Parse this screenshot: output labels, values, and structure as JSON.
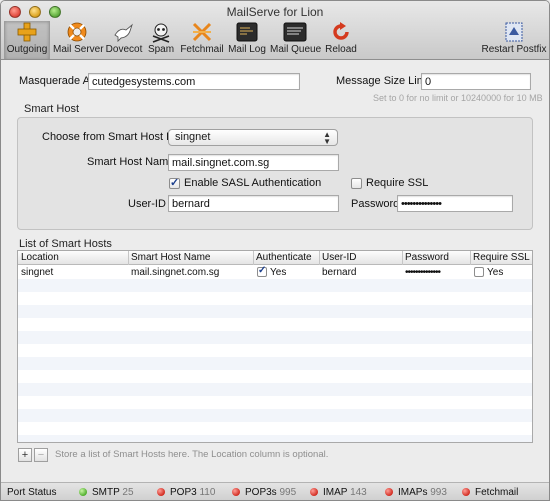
{
  "window": {
    "title": "MailServe for Lion"
  },
  "toolbar": {
    "items": [
      {
        "label": "Outgoing"
      },
      {
        "label": "Mail Server"
      },
      {
        "label": "Dovecot"
      },
      {
        "label": "Spam"
      },
      {
        "label": "Fetchmail"
      },
      {
        "label": "Mail Log"
      },
      {
        "label": "Mail Queue"
      },
      {
        "label": "Reload"
      },
      {
        "label": "Restart Postfix"
      }
    ]
  },
  "form": {
    "masquerade_label": "Masquerade As",
    "masquerade_value": "cutedgesystems.com",
    "size_limit_label": "Message Size Limit",
    "size_limit_value": "0",
    "size_limit_hint": "Set to 0 for no limit or 10240000 for 10 MB"
  },
  "smart_host": {
    "section_title": "Smart Host",
    "choose_label": "Choose from Smart Host List",
    "choose_value": "singnet",
    "name_label": "Smart Host Name",
    "name_value": "mail.singnet.com.sg",
    "sasl_label": "Enable SASL Authentication",
    "sasl_checked": true,
    "ssl_label": "Require SSL",
    "ssl_checked": false,
    "userid_label": "User-ID",
    "userid_value": "bernard",
    "password_label": "Password",
    "password_value": "••••••••••••••"
  },
  "smart_host_list": {
    "section_title": "List of Smart Hosts",
    "columns": [
      "Location",
      "Smart Host Name",
      "Authenticate",
      "User-ID",
      "Password",
      "Require SSL"
    ],
    "rows": [
      {
        "location": "singnet",
        "host": "mail.singnet.com.sg",
        "authenticate": true,
        "authenticate_label": "Yes",
        "userid": "bernard",
        "password": "••••••••••••••",
        "ssl": false,
        "ssl_label": "Yes"
      }
    ],
    "add_label": "+",
    "remove_label": "−",
    "hint": "Store a list of Smart Hosts here. The Location column is optional."
  },
  "status": {
    "label": "Port Status",
    "services": [
      {
        "name": "SMTP",
        "port": "25",
        "status": "on"
      },
      {
        "name": "POP3",
        "port": "110",
        "status": "off"
      },
      {
        "name": "POP3s",
        "port": "995",
        "status": "off"
      },
      {
        "name": "IMAP",
        "port": "143",
        "status": "off"
      },
      {
        "name": "IMAPs",
        "port": "993",
        "status": "off"
      },
      {
        "name": "Fetchmail",
        "port": "",
        "status": "off"
      }
    ],
    "colors": {
      "on": "#4fae2c",
      "off": "#d12b20"
    }
  }
}
